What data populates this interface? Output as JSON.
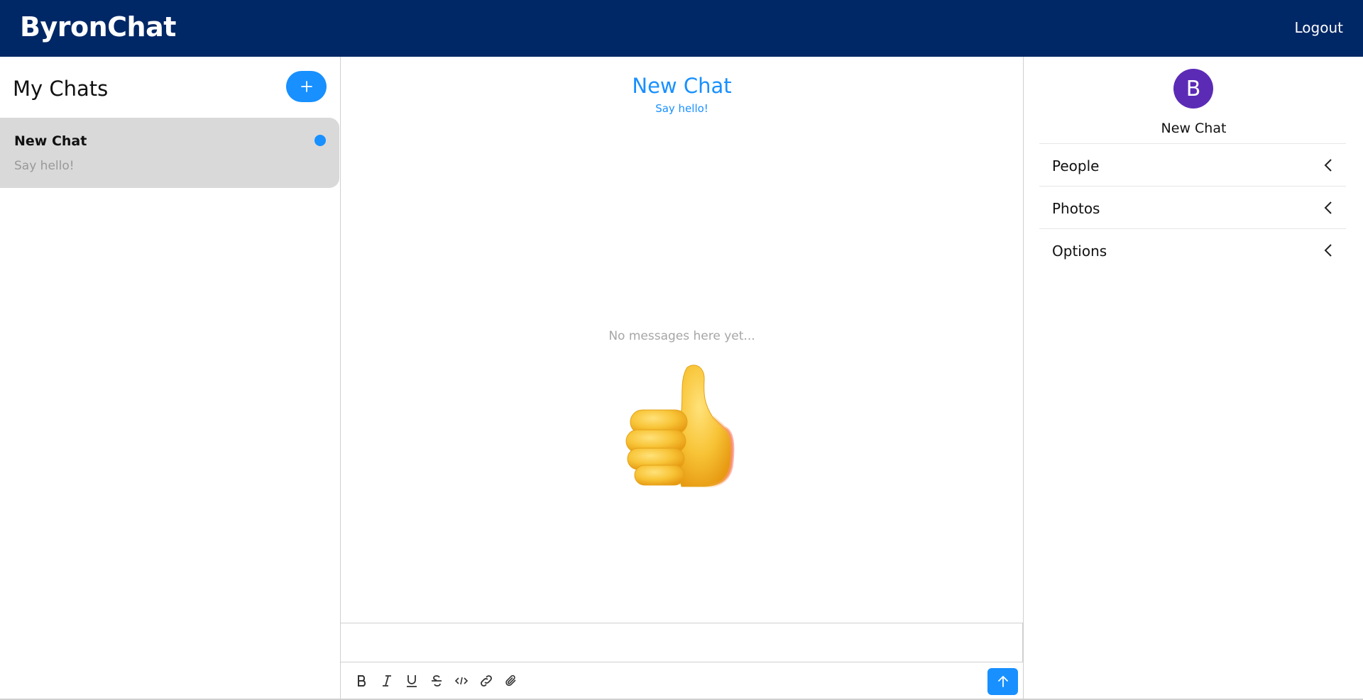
{
  "header": {
    "brand": "ByronChat",
    "logout_label": "Logout"
  },
  "sidebar": {
    "title": "My Chats",
    "add_icon": "plus-icon",
    "chats": [
      {
        "title": "New Chat",
        "preview": "Say hello!",
        "unread": true
      }
    ]
  },
  "main": {
    "title": "New Chat",
    "subtitle": "Say hello!",
    "empty_text": "No messages here yet...",
    "empty_icon": "thumbs-up-icon",
    "composer": {
      "value": "",
      "tools": [
        "bold-icon",
        "italic-icon",
        "underline-icon",
        "strikethrough-icon",
        "code-icon",
        "link-icon",
        "attachment-icon"
      ],
      "send_icon": "arrow-up-icon"
    }
  },
  "details": {
    "avatar_letter": "B",
    "title": "New Chat",
    "sections": [
      {
        "label": "People"
      },
      {
        "label": "Photos"
      },
      {
        "label": "Options"
      }
    ]
  },
  "colors": {
    "header_bg": "#002766",
    "accent": "#1890ff",
    "avatar_bg": "#5b2bb6",
    "active_chat_bg": "#d9d9d9"
  }
}
